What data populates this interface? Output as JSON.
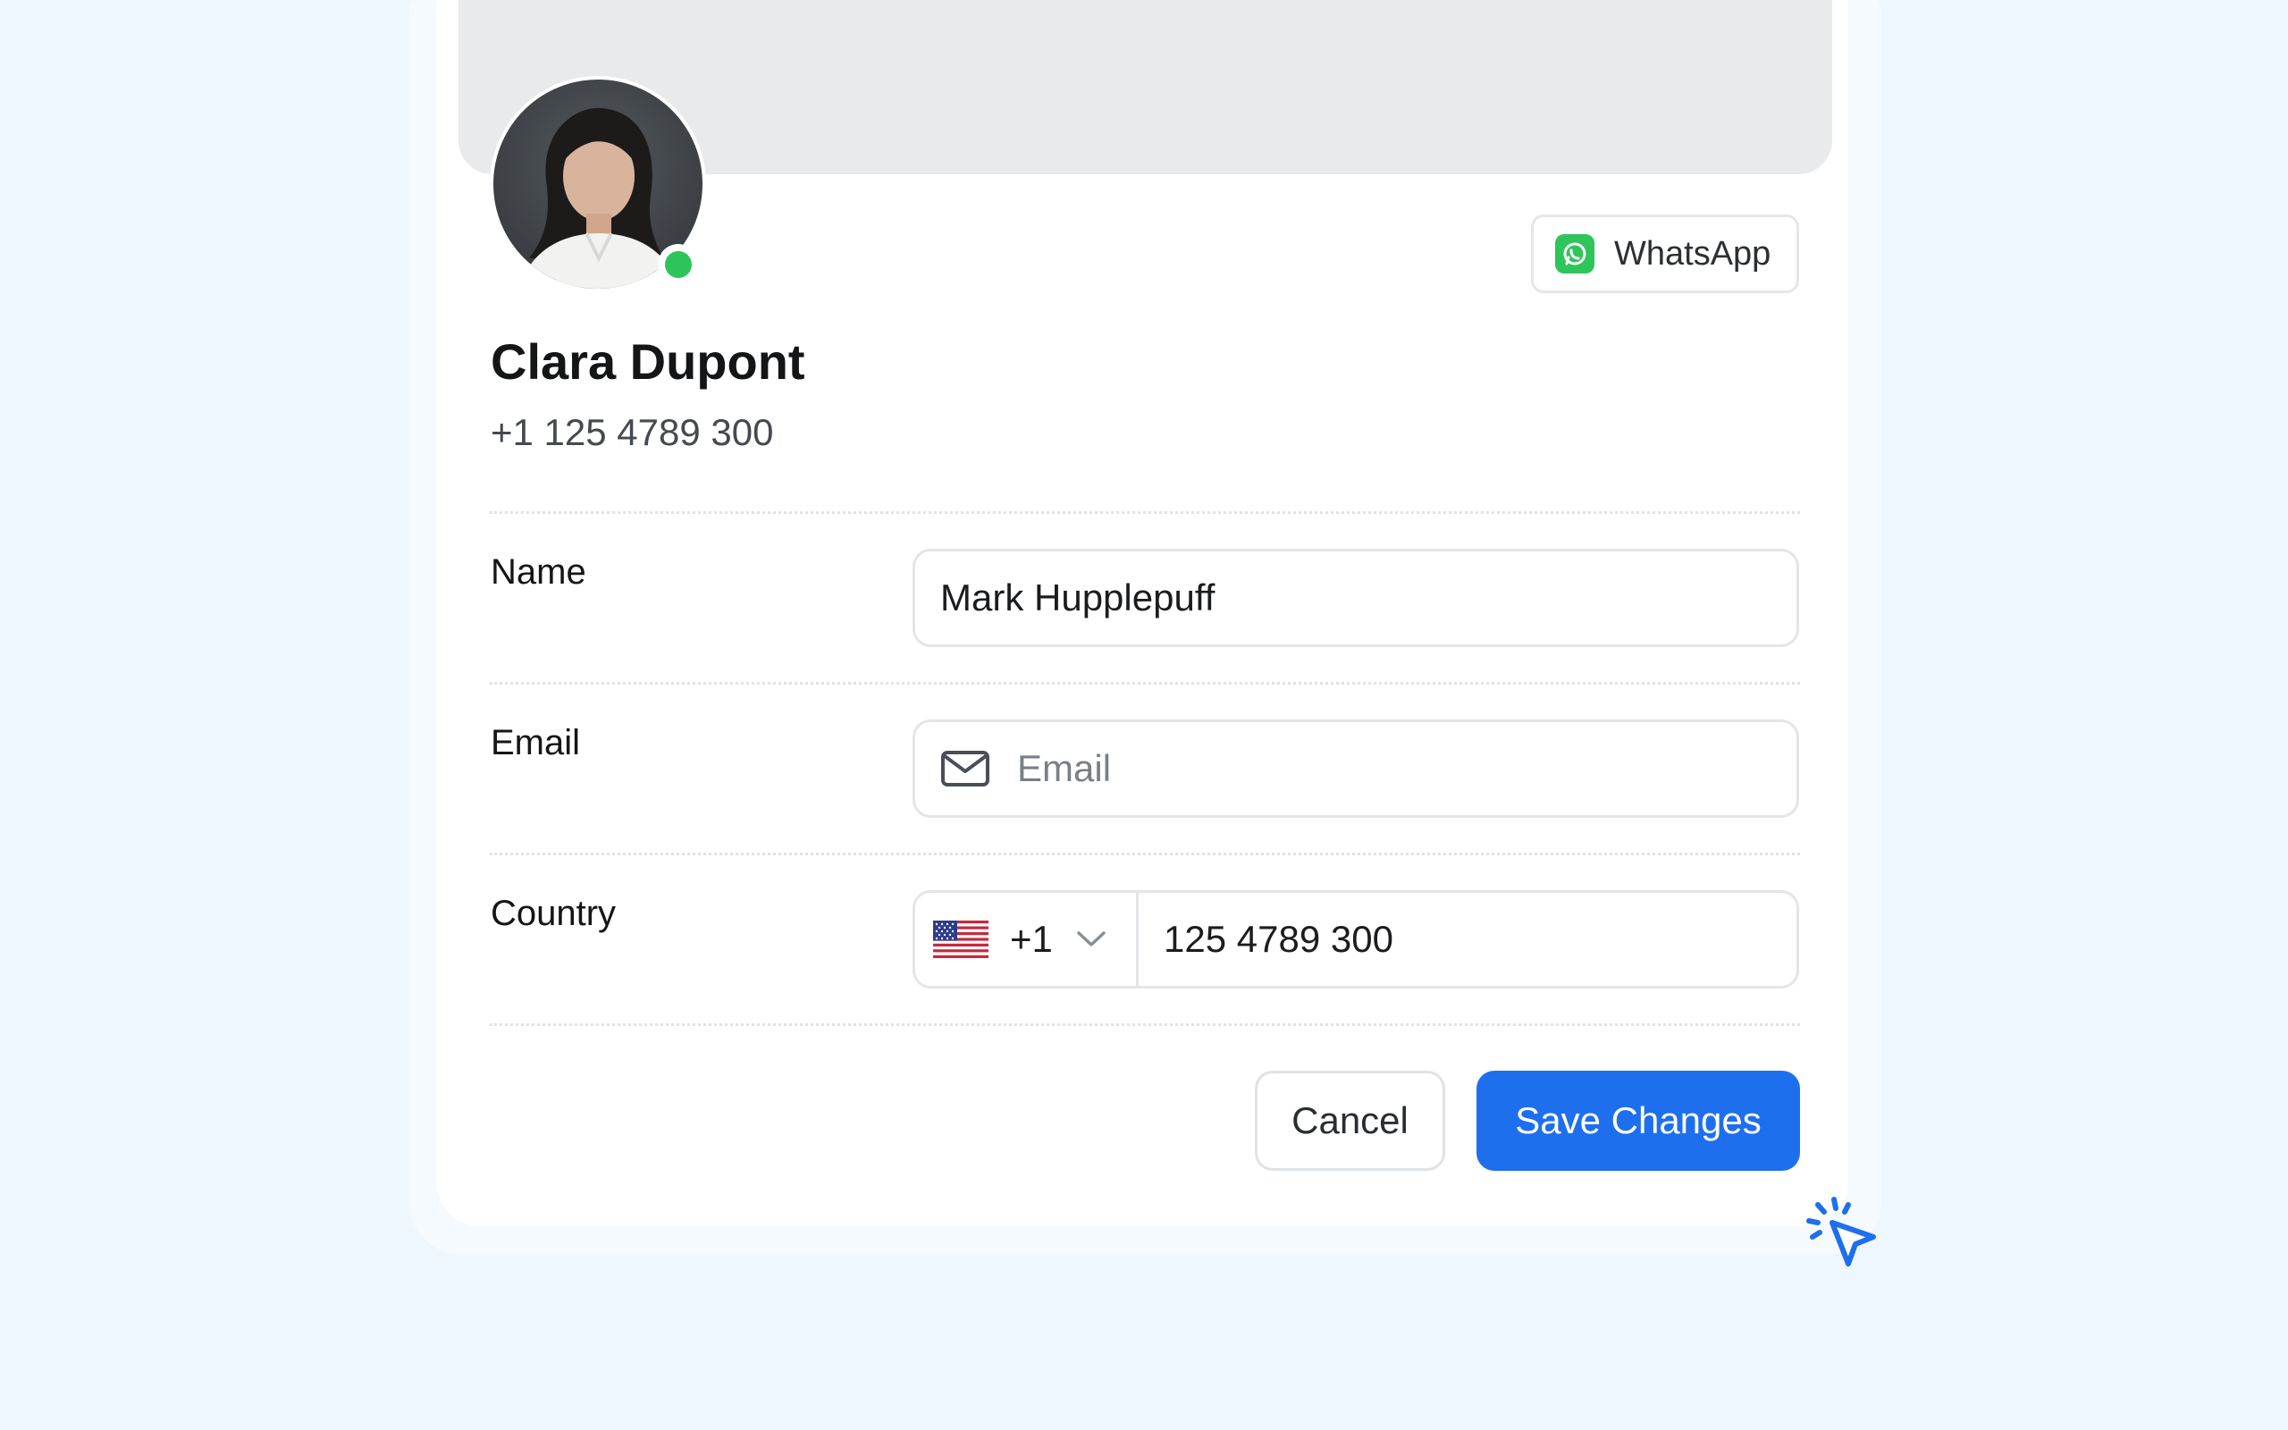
{
  "profile": {
    "name": "Clara Dupont",
    "phone": "+1 125 4789 300",
    "status": "online"
  },
  "contact_channel": {
    "label": "WhatsApp",
    "icon": "whatsapp-icon"
  },
  "form": {
    "name": {
      "label": "Name",
      "value": "Mark Hupplepuff"
    },
    "email": {
      "label": "Email",
      "placeholder": "Email",
      "value": "",
      "icon": "mail-icon"
    },
    "country": {
      "label": "Country",
      "flag": "us-flag-icon",
      "dial_code": "+1",
      "phone_value": "125 4789 300"
    }
  },
  "actions": {
    "cancel_label": "Cancel",
    "save_label": "Save Changes"
  },
  "colors": {
    "primary": "#1e6fee",
    "online": "#2cc55a",
    "whatsapp": "#2ec55b",
    "background": "#eef6fe"
  }
}
